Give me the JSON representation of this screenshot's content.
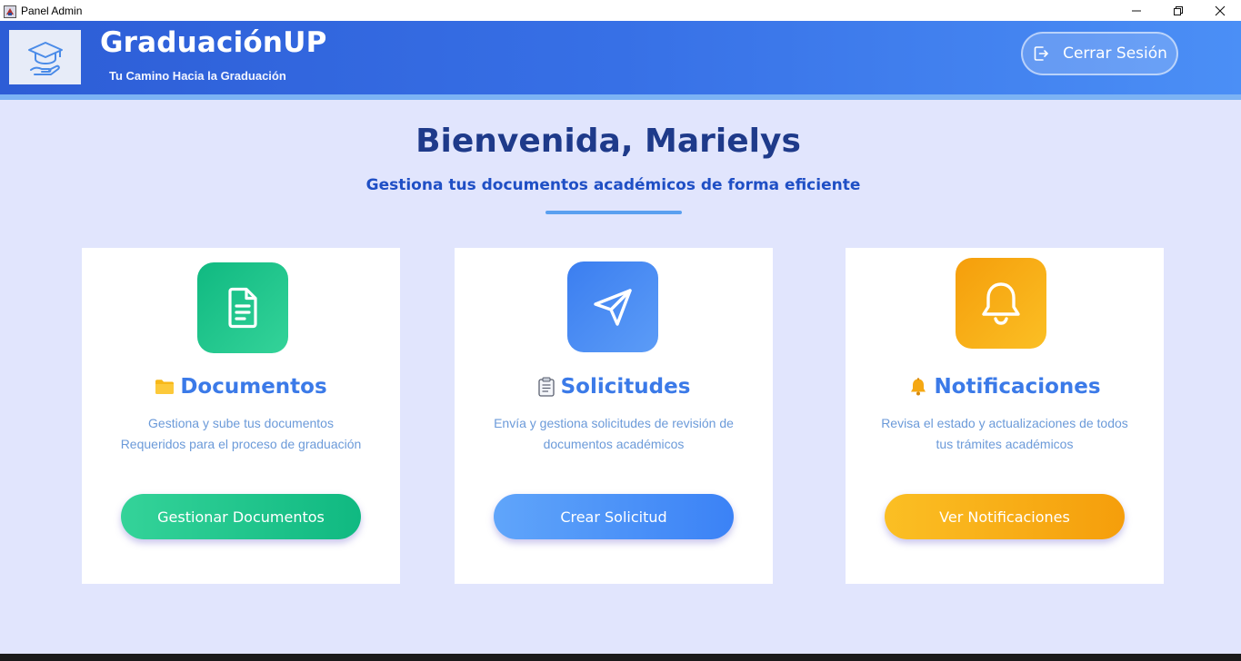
{
  "window": {
    "title": "Panel Admin"
  },
  "header": {
    "brand": "GraduaciónUP",
    "tagline": "Tu Camino Hacia la Graduación",
    "logout_label": "Cerrar Sesión"
  },
  "welcome": {
    "title": "Bienvenida, Marielys",
    "subtitle": "Gestiona tus documentos académicos de forma eficiente"
  },
  "cards": [
    {
      "title": "Documentos",
      "desc_line1": "Gestiona y sube tus documentos",
      "desc_line2": "Requeridos para el proceso de graduación",
      "button": "Gestionar Documentos",
      "icon": "document-icon",
      "color": "#10b981"
    },
    {
      "title": "Solicitudes",
      "desc_line1": "Envía y gestiona solicitudes de revisión de",
      "desc_line2": "documentos académicos",
      "button": "Crear Solicitud",
      "icon": "paper-plane-icon",
      "color": "#3b82f6"
    },
    {
      "title": "Notificaciones",
      "desc_line1": "Revisa el estado y actualizaciones de todos",
      "desc_line2": "tus trámites académicos",
      "button": "Ver Notificaciones",
      "icon": "bell-icon",
      "color": "#f59e0b"
    }
  ],
  "colors": {
    "header_start": "#2d5dd6",
    "header_end": "#4b8ff6",
    "background": "#e1e5fd",
    "heading": "#1e3a8a",
    "card_title": "#3b7ae8"
  }
}
